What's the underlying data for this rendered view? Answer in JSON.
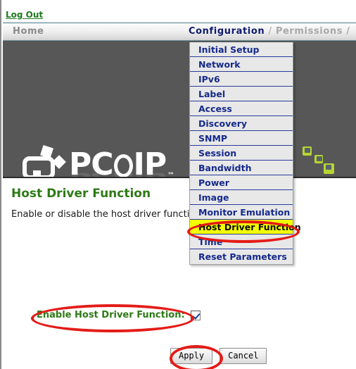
{
  "header": {
    "logout_label": "Log Out"
  },
  "nav": {
    "home_label": "Home",
    "configuration_label": "Configuration",
    "separator": " / ",
    "permissions_label": "Permissions /"
  },
  "banner": {
    "logo_text_pre": "PC",
    "logo_text_post": "IP",
    "trademark": "™"
  },
  "page": {
    "title": "Host Driver Function",
    "description": "Enable or disable the host driver function"
  },
  "dropdown": {
    "items": [
      {
        "label": "Initial Setup",
        "selected": false
      },
      {
        "label": "Network",
        "selected": false
      },
      {
        "label": "IPv6",
        "selected": false
      },
      {
        "label": "Label",
        "selected": false
      },
      {
        "label": "Access",
        "selected": false
      },
      {
        "label": "Discovery",
        "selected": false
      },
      {
        "label": "SNMP",
        "selected": false
      },
      {
        "label": "Session",
        "selected": false
      },
      {
        "label": "Bandwidth",
        "selected": false
      },
      {
        "label": "Power",
        "selected": false
      },
      {
        "label": "Image",
        "selected": false
      },
      {
        "label": "Monitor Emulation",
        "selected": false
      },
      {
        "label": "Host Driver Function",
        "selected": true
      },
      {
        "label": "Time",
        "selected": false
      },
      {
        "label": "Reset Parameters",
        "selected": false
      }
    ]
  },
  "form": {
    "checkbox_label": "Enable Host Driver Function:",
    "checkbox_checked": true,
    "apply_label": "Apply",
    "cancel_label": "Cancel"
  },
  "colors": {
    "link_green": "#1f7a1f",
    "title_green": "#2d7a16",
    "nav_active_blue": "#101b6e",
    "menu_blue": "#152a8c",
    "highlight_yellow": "#f2ff00",
    "annotation_red": "#e41b17",
    "banner_gray": "#575757",
    "cube_green": "#b8d432"
  }
}
